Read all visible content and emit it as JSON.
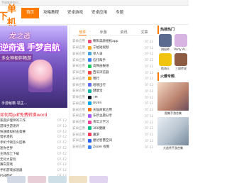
{
  "topbar": {
    "text": "手机软件你已..."
  },
  "logo": {
    "part1": "下",
    "part2": "单机"
  },
  "nav": [
    "首页",
    "攻略教程",
    "安卓游戏",
    "安卓应用",
    "专题"
  ],
  "banner": {
    "title": "龙之逃",
    "headline": "逆奇遇 手梦启航",
    "tag": "多女神相伴畅游",
    "caption": "手游秘籍·领主..."
  },
  "left": {
    "headline": "如何用pdf免费转换word",
    "rows": [
      {
        "name": "家庭护理师的工作",
        "date": "07-12"
      },
      {
        "name": "游戏手游测评",
        "date": "07-12"
      },
      {
        "name": "快速模拟射击第赛",
        "date": "07-12"
      },
      {
        "name": "猎杀潜航",
        "date": "07-12"
      },
      {
        "name": "手机卡顿怎么回事",
        "date": "07-12"
      },
      {
        "name": "迷你世界",
        "date": "07-12"
      },
      {
        "name": "王牌战士下载",
        "date": "07-12"
      },
      {
        "name": "无尽大冒险",
        "date": "07-12"
      },
      {
        "name": "赛车游戏",
        "date": "07-12"
      },
      {
        "name": "手机游戏加速器",
        "date": "07-12"
      },
      {
        "name": "PS4模式",
        "date": "07-12"
      }
    ]
  },
  "tabs": [
    "软件",
    "手游",
    "资讯",
    "文章"
  ],
  "apps": [
    {
      "cat": "安卓应用",
      "name": "朝阳美颜相机app",
      "date": "07-12",
      "color": "#e94e77"
    },
    {
      "cat": "安卓应用",
      "name": "宁拍短视频",
      "date": "07-12",
      "color": "#f6a623"
    },
    {
      "cat": "安卓应用",
      "name": "单人录",
      "date": "07-12",
      "color": "#4aa3df"
    },
    {
      "cat": "安卓应用",
      "name": "信托帮手",
      "date": "07-12",
      "color": "#3b82f6"
    },
    {
      "cat": "安卓应用",
      "name": "高铁画报纸",
      "date": "07-12",
      "color": "#22c55e"
    },
    {
      "cat": "安卓应用",
      "name": "西瓜浏览器",
      "date": "07-12",
      "color": "#ef4444"
    },
    {
      "cat": "安卓应用",
      "name": "锦行",
      "date": "07-12",
      "color": "#f59e0b"
    },
    {
      "cat": "安卓应用",
      "name": "哈喽出行",
      "date": "07-12",
      "color": "#6366f1"
    },
    {
      "cat": "安卓应用",
      "name": "健康宝",
      "date": "07-12",
      "color": "#14b8a6"
    },
    {
      "cat": "安卓应用",
      "name": "TM",
      "date": "07-12",
      "color": "#111827"
    },
    {
      "cat": "安卓应用",
      "name": "UUdn",
      "date": "07-12",
      "color": "#0ea5e9"
    },
    {
      "cat": "安卓应用",
      "name": "天猫商家应用",
      "date": "07-12",
      "color": "#f97316"
    },
    {
      "cat": "安卓应用",
      "name": "乐新主题分享",
      "date": "07-12",
      "color": "#a855f7"
    },
    {
      "cat": "安卓应用",
      "name": "青年大学习",
      "date": "07-12",
      "color": "#ec4899"
    },
    {
      "cat": "安卓应用",
      "name": "360健康",
      "date": "07-12",
      "color": "#10b981"
    },
    {
      "cat": "安卓应用",
      "name": "趣游",
      "date": "07-12",
      "color": "#f43f5e"
    },
    {
      "cat": "安卓应用",
      "name": "捷达智慧空间",
      "date": "07-12",
      "color": "#2563eb"
    },
    {
      "cat": "安卓应用",
      "name": "Zoom 视频",
      "date": "07-12",
      "color": "#3b82f6"
    }
  ],
  "right": {
    "header1": "热搜热门",
    "games": [
      {
        "label": "阴阳师",
        "color": "#5b6b8f"
      },
      {
        "label": "Party Ar...",
        "color": "#d8b4e2"
      },
      {
        "label": "航海王",
        "color": "#f1c40f"
      },
      {
        "label": "三国传说",
        "color": "#8e5c42"
      }
    ],
    "header2": "火爆专题",
    "cards": [
      {
        "caption": "图集手游合集"
      },
      {
        "caption": "大逃杀手游合集"
      }
    ]
  }
}
